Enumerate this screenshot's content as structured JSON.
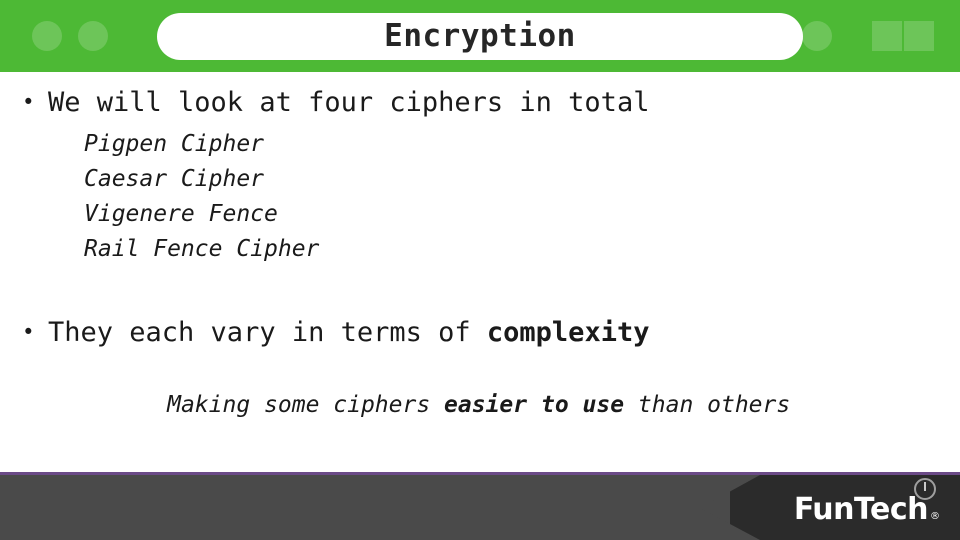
{
  "slide": {
    "title": "Encryption",
    "bullets": [
      {
        "marker": "•",
        "text": "We will look at four ciphers in total",
        "sub_items": [
          "Pigpen Cipher",
          "Caesar Cipher",
          "Vigenere Fence",
          "Rail Fence Cipher"
        ]
      },
      {
        "marker": "•",
        "text_plain": "They each vary in terms of ",
        "text_bold": "complexity",
        "sub_item_parts": [
          {
            "text": "Making some ciphers ",
            "style": "italic"
          },
          {
            "text": "easier to use",
            "style": "bold-italic"
          },
          {
            "text": " than others",
            "style": "italic"
          }
        ]
      }
    ]
  },
  "footer": {
    "logo_text": "FunTech",
    "logo_registered": "®",
    "power_icon": "power-icon"
  },
  "colors": {
    "header_green": "#4db935",
    "footer_dark": "#2b2b2b",
    "footer_light": "#4a4a4a",
    "accent_purple": "#6b4a87",
    "text": "#1a1a1a"
  }
}
